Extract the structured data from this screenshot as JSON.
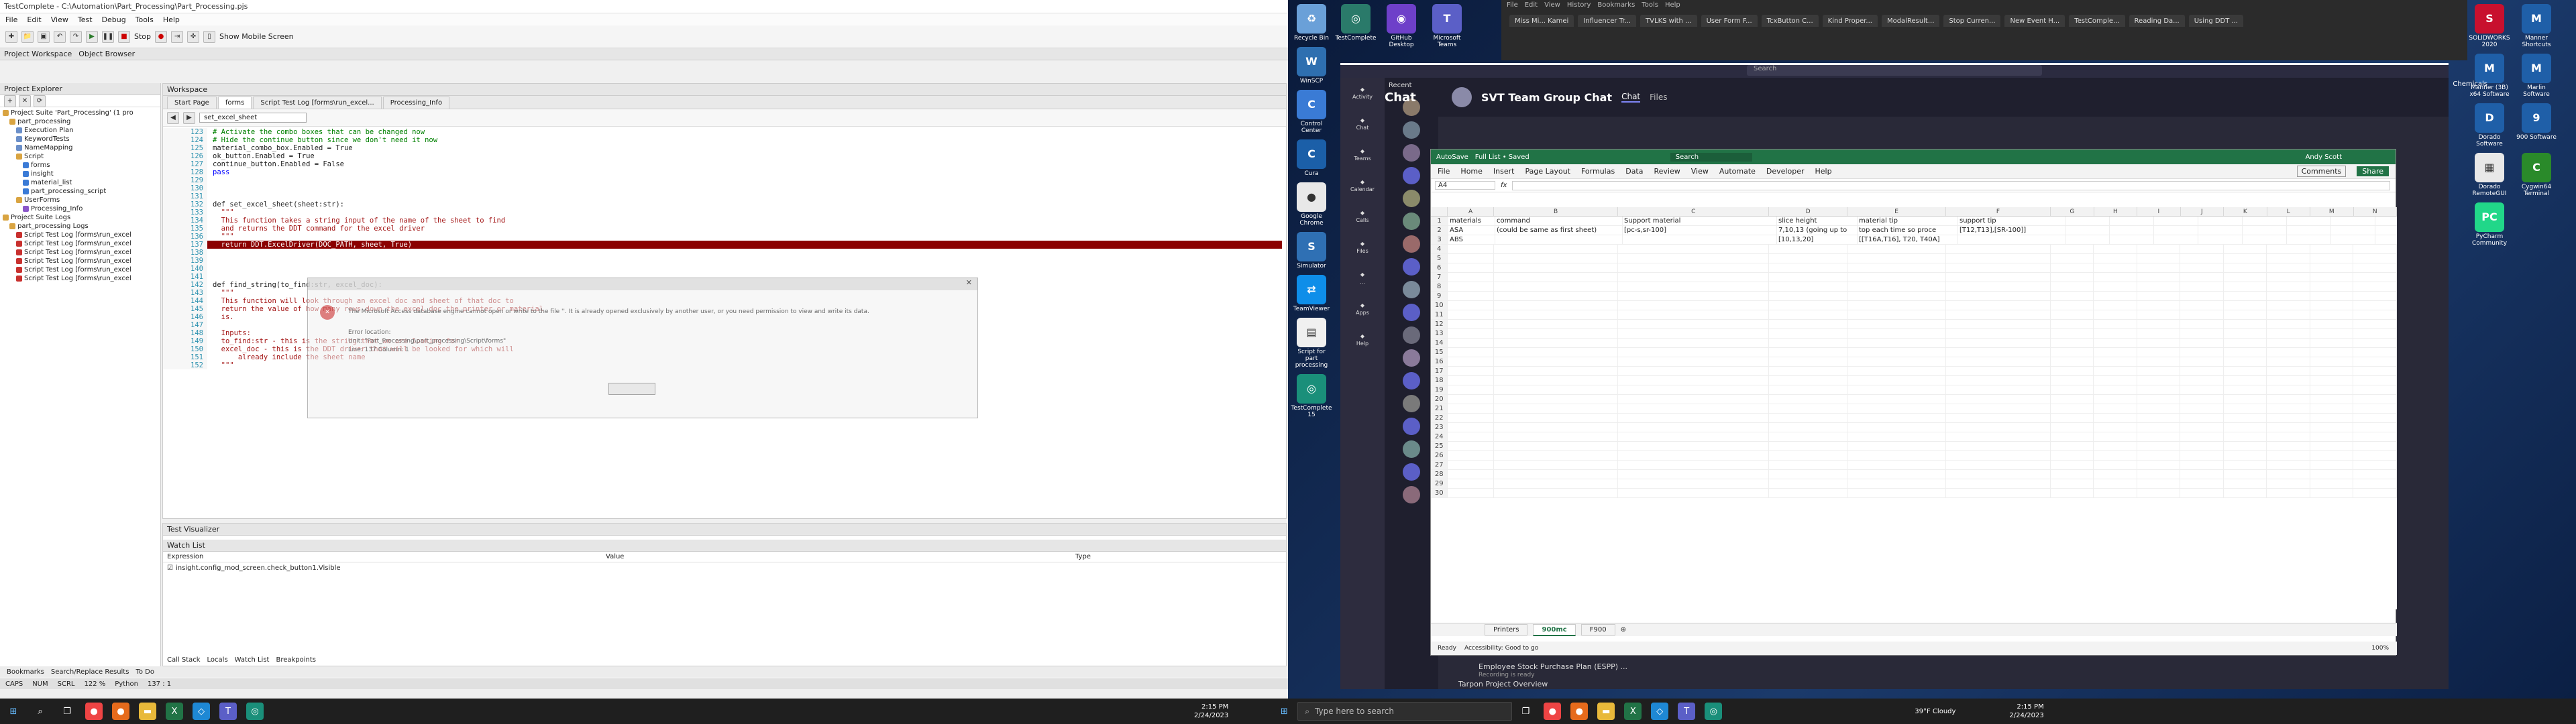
{
  "testcomplete": {
    "title": "TestComplete - C:\\Automation\\Part_Processing\\Part_Processing.pjs",
    "menu": [
      "File",
      "Edit",
      "View",
      "Test",
      "Debug",
      "Tools",
      "Help"
    ],
    "stop_label": "Stop",
    "mobile_label": "Show Mobile Screen",
    "panel_tabs": [
      "Project Workspace",
      "Object Browser"
    ],
    "project_explorer_label": "Project Explorer",
    "tree": [
      "Project Suite 'Part_Processing' (1 pro",
      "part_processing",
      "Execution Plan",
      "KeywordTests",
      "NameMapping",
      "Script",
      "forms",
      "insight",
      "material_list",
      "part_processing_script",
      "UserForms",
      "Processing_Info",
      "Project Suite Logs",
      "part_processing Logs",
      "Script Test Log [forms\\run_excel",
      "Script Test Log [forms\\run_excel",
      "Script Test Log [forms\\run_excel",
      "Script Test Log [forms\\run_excel",
      "Script Test Log [forms\\run_excel",
      "Script Test Log [forms\\run_excel"
    ],
    "workspace_label": "Workspace",
    "tabs": [
      "Start Page",
      "forms",
      "Script Test Log [forms\\run_excel...",
      "Processing_Info"
    ],
    "routine_select": "set_excel_sheet",
    "code_lines": [
      {
        "n": "123",
        "t": "# Activate the combo boxes that can be changed now",
        "c": "cm"
      },
      {
        "n": "124",
        "t": "# Hide the continue button since we don't need it now",
        "c": "cm"
      },
      {
        "n": "125",
        "t": "material_combo_box.Enabled = True",
        "c": ""
      },
      {
        "n": "126",
        "t": "ok_button.Enabled = True",
        "c": ""
      },
      {
        "n": "127",
        "t": "continue_button.Enabled = False",
        "c": ""
      },
      {
        "n": "128",
        "t": "pass",
        "c": "kw"
      },
      {
        "n": "129",
        "t": "",
        "c": ""
      },
      {
        "n": "130",
        "t": "",
        "c": ""
      },
      {
        "n": "131",
        "t": "",
        "c": ""
      },
      {
        "n": "132",
        "t": "def set_excel_sheet(sheet:str):",
        "c": ""
      },
      {
        "n": "133",
        "t": "  \"\"\"",
        "c": "st"
      },
      {
        "n": "134",
        "t": "  This function takes a string input of the name of the sheet to find",
        "c": "st"
      },
      {
        "n": "135",
        "t": "  and returns the DDT command for the excel driver",
        "c": "st"
      },
      {
        "n": "136",
        "t": "  \"\"\"",
        "c": "st"
      },
      {
        "n": "137",
        "t": "  return DDT.ExcelDriver(DOC_PATH, sheet, True)",
        "c": "err"
      },
      {
        "n": "138",
        "t": "",
        "c": ""
      },
      {
        "n": "139",
        "t": "",
        "c": ""
      },
      {
        "n": "140",
        "t": "",
        "c": ""
      },
      {
        "n": "141",
        "t": "",
        "c": ""
      },
      {
        "n": "142",
        "t": "def find_string(to_find:str, excel_doc):",
        "c": ""
      },
      {
        "n": "143",
        "t": "  \"\"\"",
        "c": "st"
      },
      {
        "n": "144",
        "t": "  This function will look through an excel doc and sheet of that doc to",
        "c": "st"
      },
      {
        "n": "145",
        "t": "  return the value of how many rows down the excel doc the printer or material",
        "c": "st"
      },
      {
        "n": "146",
        "t": "  is.",
        "c": "st"
      },
      {
        "n": "147",
        "t": "",
        "c": ""
      },
      {
        "n": "148",
        "t": "  Inputs:",
        "c": "st"
      },
      {
        "n": "149",
        "t": "  to_find:str - this is the string that we are looking for",
        "c": "st"
      },
      {
        "n": "150",
        "t": "  excel_doc - this is the DDT driver that will be looked for which will",
        "c": "st"
      },
      {
        "n": "151",
        "t": "      already include the sheet name",
        "c": "st"
      },
      {
        "n": "152",
        "t": "  \"\"\"",
        "c": "st"
      }
    ],
    "error_dialog": {
      "message": "The Microsoft Access database engine cannot open or write to the file ''. It is already opened exclusively by another user, or you need permission to view and write its data.",
      "loc_title": "Error location:",
      "loc_unit": "Unit: \"Part_Processing\\part_processing\\Script\\forms\"",
      "loc_line": "Line: 137 Column: 1"
    },
    "test_visualizer_label": "Test Visualizer",
    "watch_list_label": "Watch List",
    "watch_headers": [
      "Expression",
      "Value",
      "Type"
    ],
    "watch_row": "insight.config_mod_screen.check_button1.Visible",
    "bottom_tabs": [
      "Call Stack",
      "Locals",
      "Watch List",
      "Breakpoints"
    ],
    "left_bottom_tabs": [
      "Bookmarks",
      "Search/Replace Results",
      "To Do"
    ],
    "status": [
      "CAPS",
      "NUM",
      "SCRL",
      "122 %",
      "Python",
      "137 : 1"
    ]
  },
  "desktop_icons_left": [
    {
      "label": "Recycle Bin",
      "color": "#6aa0d8",
      "glyph": "♻"
    },
    {
      "label": "WinSCP",
      "color": "#2e6fb0",
      "glyph": "W"
    },
    {
      "label": "Control Center",
      "color": "#3a7bd5",
      "glyph": "C"
    },
    {
      "label": "Cura",
      "color": "#1b5fa8",
      "glyph": "C"
    },
    {
      "label": "Google Chrome",
      "color": "#e8e8e8",
      "glyph": "●"
    },
    {
      "label": "Simulator",
      "color": "#2f70b4",
      "glyph": "S"
    },
    {
      "label": "TeamViewer",
      "color": "#0e8ee9",
      "glyph": "⇄"
    },
    {
      "label": "Script for part processing",
      "color": "#f0f0f0",
      "glyph": "▤"
    },
    {
      "label": "TestComplete 15",
      "color": "#1a8f7a",
      "glyph": "◎"
    }
  ],
  "desktop_icons_col2": [
    {
      "label": "TestComplete",
      "color": "#2a7a6a",
      "glyph": "◎"
    },
    {
      "label": "GitHub Desktop",
      "color": "#6e40c9",
      "glyph": "◉"
    },
    {
      "label": "Microsoft Teams",
      "color": "#5b5fc7",
      "glyph": "T"
    }
  ],
  "desktop_icons_right": [
    {
      "label": "SOLIDWORKS 2020",
      "color": "#c8102e",
      "glyph": "S"
    },
    {
      "label": "Manner Shortcuts",
      "color": "#1f5fa8",
      "glyph": "M"
    },
    {
      "label": "Manner (3B) x64 Software",
      "color": "#1f5fa8",
      "glyph": "M"
    },
    {
      "label": "Marlin Software",
      "color": "#1f5fa8",
      "glyph": "M"
    },
    {
      "label": "Dorado Software",
      "color": "#1f5fa8",
      "glyph": "D"
    },
    {
      "label": "900 Software",
      "color": "#1f5fa8",
      "glyph": "9"
    },
    {
      "label": "Dorado RemoteGUI",
      "color": "#e8e8e8",
      "glyph": "▦"
    },
    {
      "label": "Cygwin64 Terminal",
      "color": "#2a8a2a",
      "glyph": "C"
    },
    {
      "label": "PyCharm Community",
      "color": "#21d789",
      "glyph": "PC"
    }
  ],
  "browser": {
    "tabs": [
      "Miss Mi... Kamei",
      "Influencer Tr...",
      "TVLKS with ...",
      "User Form F...",
      "TcxButton C...",
      "Kind Proper...",
      "ModalResult...",
      "Stop Curren...",
      "New Event H...",
      "TestComple...",
      "Reading Da...",
      "Using DDT ..."
    ],
    "menu": [
      "File",
      "Edit",
      "View",
      "History",
      "Bookmarks",
      "Tools",
      "Help"
    ],
    "side_label": "Chemicals"
  },
  "teams": {
    "title": "Chat",
    "group": "SVT Team Group Chat",
    "chat_tab": "Chat",
    "files_tab": "Files",
    "rail": [
      "Activity",
      "Chat",
      "Teams",
      "Calendar",
      "Calls",
      "Files",
      "...",
      "Apps",
      "Help"
    ],
    "recent_label": "Recent",
    "search_placeholder": "Search",
    "bottom_msg": "Employee Stock Purchase Plan (ESPP) ...",
    "bottom_msg2": "Tarpon Project Overview",
    "recording": "Recording is ready"
  },
  "excel": {
    "autosave": "AutoSave",
    "filename": "Full List • Saved",
    "search": "Search",
    "user": "Andy Scott",
    "menu": [
      "File",
      "Home",
      "Insert",
      "Page Layout",
      "Formulas",
      "Data",
      "Review",
      "View",
      "Automate",
      "Developer",
      "Help"
    ],
    "comments": "Comments",
    "share": "Share",
    "name_box": "A4",
    "fx": "fx",
    "columns": [
      "A",
      "B",
      "C",
      "D",
      "E",
      "F",
      "G",
      "H",
      "I",
      "J",
      "K",
      "L",
      "M",
      "N"
    ],
    "rows": [
      [
        "1",
        "materials",
        "command",
        "Support material",
        "slice height",
        "material tip",
        "support tip",
        "",
        "",
        "",
        "",
        "",
        "",
        ""
      ],
      [
        "2",
        "ASA",
        "(could be same as first sheet)",
        "[pc-s,sr-100]",
        "7,10,13 (going up to",
        "top each time so proce",
        "[T12,T13],[SR-100]]",
        "",
        "",
        "",
        "",
        "",
        "",
        ""
      ],
      [
        "3",
        "ABS",
        "",
        "",
        "[10,13,20]",
        "[[T16A,T16], T20, T40A]",
        "",
        "",
        "",
        "",
        "",
        "",
        "",
        ""
      ]
    ],
    "row_count": 30,
    "sheets": [
      "Printers",
      "900mc",
      "F900"
    ],
    "active_sheet": "900mc",
    "status_ready": "Ready",
    "accessibility": "Accessibility: Good to go",
    "zoom": "100%"
  },
  "taskbar": {
    "search_placeholder": "Type here to search",
    "time_left": "2:15 PM",
    "date_left": "2/24/2023",
    "weather": "39°F Cloudy",
    "time_right": "2:15 PM",
    "date_right": "2/24/2023"
  }
}
